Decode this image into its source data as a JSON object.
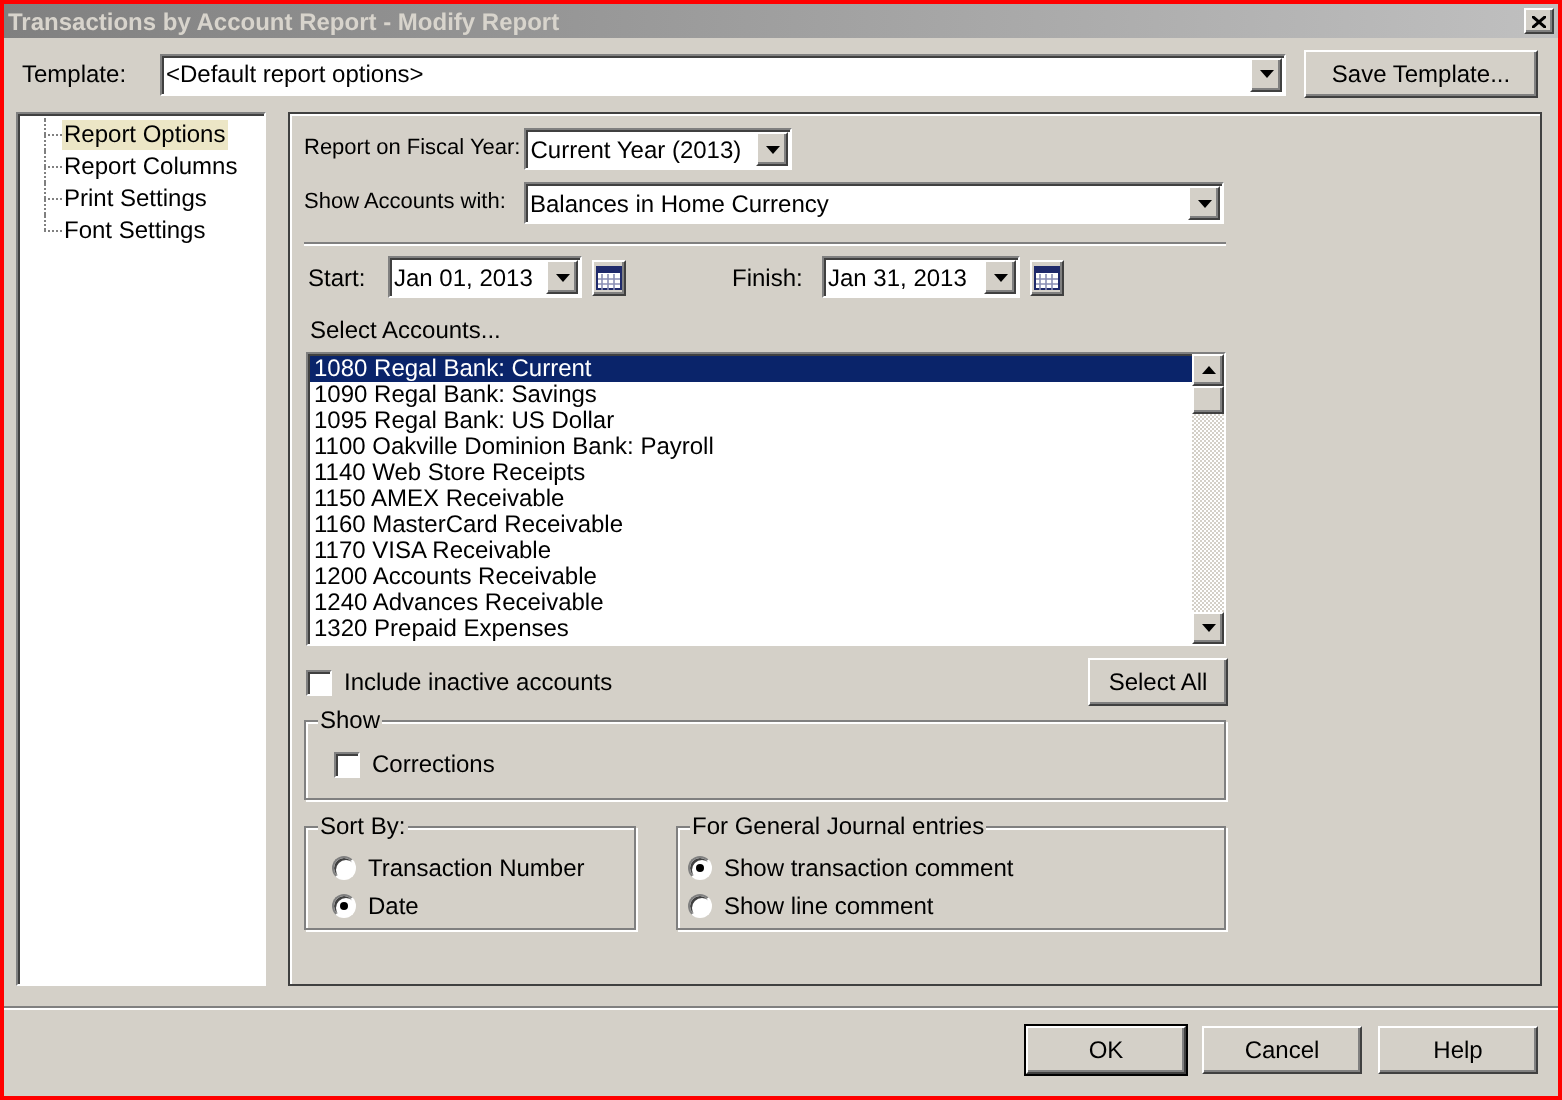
{
  "window": {
    "title": "Transactions by Account Report - Modify Report"
  },
  "template": {
    "label": "Template:",
    "value": "<Default report options>"
  },
  "save_template_button": "Save Template...",
  "sidebar": {
    "items": [
      {
        "label": "Report Options",
        "selected": true
      },
      {
        "label": "Report Columns",
        "selected": false
      },
      {
        "label": "Print Settings",
        "selected": false
      },
      {
        "label": "Font Settings",
        "selected": false
      }
    ]
  },
  "fiscal_year": {
    "label": "Report on Fiscal Year:",
    "value": "Current Year (2013)"
  },
  "show_accounts": {
    "label": "Show Accounts with:",
    "value": "Balances in Home Currency"
  },
  "start": {
    "label": "Start:",
    "value": "Jan 01, 2013"
  },
  "finish": {
    "label": "Finish:",
    "value": "Jan 31, 2013"
  },
  "select_accounts": {
    "label": "Select Accounts...",
    "items": [
      {
        "label": "1080 Regal Bank: Current",
        "selected": true
      },
      {
        "label": "1090 Regal Bank: Savings",
        "selected": false
      },
      {
        "label": "1095 Regal Bank: US Dollar",
        "selected": false
      },
      {
        "label": "1100 Oakville Dominion Bank: Payroll",
        "selected": false
      },
      {
        "label": "1140 Web Store Receipts",
        "selected": false
      },
      {
        "label": "1150 AMEX Receivable",
        "selected": false
      },
      {
        "label": "1160 MasterCard Receivable",
        "selected": false
      },
      {
        "label": "1170 VISA Receivable",
        "selected": false
      },
      {
        "label": "1200 Accounts Receivable",
        "selected": false
      },
      {
        "label": "1240 Advances Receivable",
        "selected": false
      },
      {
        "label": "1320 Prepaid Expenses",
        "selected": false
      }
    ]
  },
  "include_inactive": {
    "label": "Include inactive accounts",
    "checked": false
  },
  "select_all_button": "Select All",
  "show_group": {
    "title": "Show",
    "corrections": {
      "label": "Corrections",
      "checked": false
    }
  },
  "sort_by": {
    "title": "Sort By:",
    "options": [
      {
        "label": "Transaction Number",
        "selected": false
      },
      {
        "label": "Date",
        "selected": true
      }
    ]
  },
  "general_journal": {
    "title": "For General Journal entries",
    "options": [
      {
        "label": "Show transaction comment",
        "selected": true
      },
      {
        "label": "Show line comment",
        "selected": false
      }
    ]
  },
  "buttons": [
    {
      "label": "OK",
      "default": true
    },
    {
      "label": "Cancel",
      "default": false
    },
    {
      "label": "Help",
      "default": false
    }
  ]
}
